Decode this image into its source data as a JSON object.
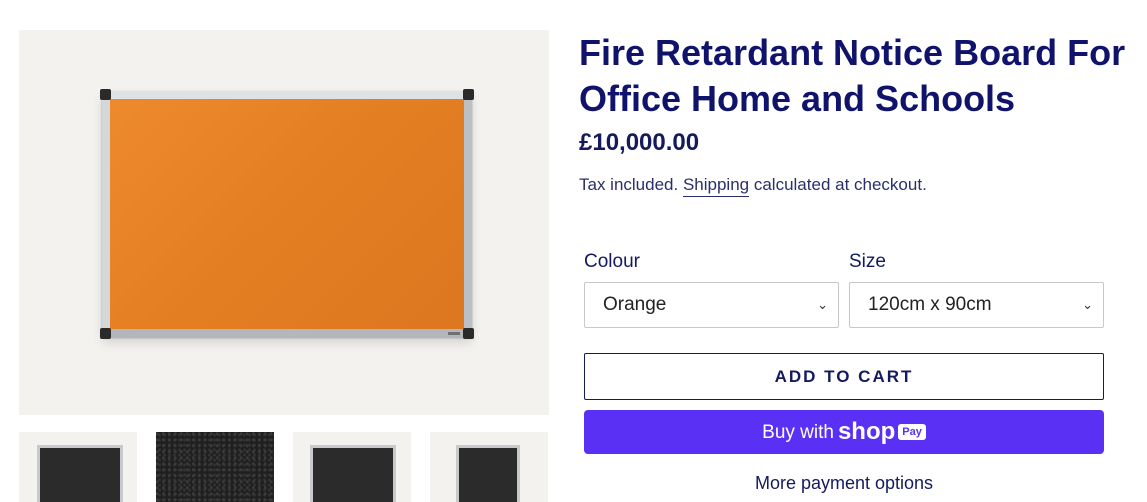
{
  "product": {
    "title": "Fire Retardant Notice Board For Office Home and Schools",
    "price": "£10,000.00",
    "tax_text": "Tax included. ",
    "shipping_link": "Shipping",
    "tax_suffix": " calculated at checkout."
  },
  "options": {
    "colour": {
      "label": "Colour",
      "value": "Orange"
    },
    "size": {
      "label": "Size",
      "value": "120cm x 90cm"
    }
  },
  "buttons": {
    "add_to_cart": "ADD TO CART",
    "buy_with": "Buy with",
    "shop_word": "shop",
    "pay_badge": "Pay",
    "more_payment": "More payment options"
  },
  "icons": {
    "select_chevron": "chevron-down-icon"
  },
  "colors": {
    "title": "#10136b",
    "board_orange": "#e57f23",
    "shop_pay": "#5a31f4"
  }
}
